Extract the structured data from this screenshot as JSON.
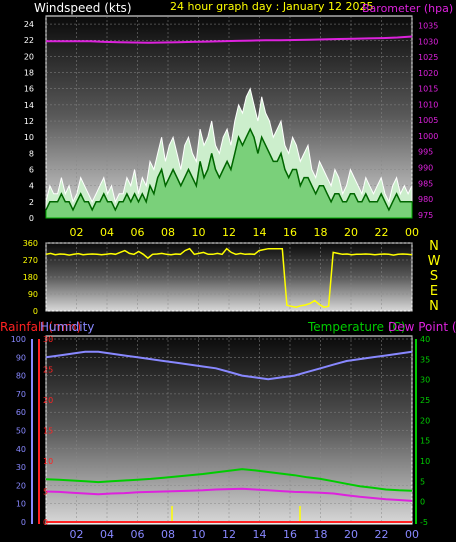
{
  "header": {
    "wind_label": "Windspeed (kts)",
    "title": "24 hour graph day :  January 12 2025",
    "baro_label": "Barometer (hpa)"
  },
  "colors": {
    "wind_label": "#ffffff",
    "title": "#ffff00",
    "baro": "#dd22dd",
    "wind_gust": "#ffffff",
    "wind_avg": "#00cc00",
    "wind_fill": "#cceecc",
    "dir": "#ffff00",
    "rain": "#ff2222",
    "humidity": "#8888ff",
    "temp": "#00cc00",
    "dew": "#dd22dd",
    "axis_yellow": "#ffff00"
  },
  "x_ticks": [
    "02",
    "04",
    "06",
    "08",
    "10",
    "12",
    "14",
    "16",
    "18",
    "20",
    "22",
    "00"
  ],
  "compass": [
    "N",
    "W",
    "S",
    "E",
    "N"
  ],
  "lower_labels": {
    "rain": "Rainfall (mm)",
    "humidity": "Humidity",
    "temp": "Temperature (C)",
    "dew": "Dew Point (C)"
  },
  "chart_data": [
    {
      "type": "area",
      "panel": "wind",
      "y_ticks": [
        "0",
        "2",
        "4",
        "6",
        "8",
        "10",
        "12",
        "14",
        "16",
        "18",
        "20",
        "22",
        "24"
      ],
      "ylim": [
        0,
        25
      ],
      "series": [
        {
          "name": "Windspeed (kts) gust",
          "values": [
            2,
            4,
            3,
            3,
            5,
            3,
            4,
            2,
            3,
            5,
            4,
            3,
            2,
            3,
            4,
            5,
            3,
            4,
            2,
            3,
            3,
            5,
            4,
            6,
            3,
            5,
            4,
            7,
            6,
            8,
            10,
            7,
            9,
            10,
            8,
            6,
            9,
            10,
            8,
            7,
            11,
            9,
            10,
            12,
            9,
            8,
            10,
            11,
            9,
            12,
            14,
            13,
            15,
            16,
            14,
            12,
            15,
            13,
            12,
            10,
            11,
            12,
            9,
            8,
            10,
            9,
            7,
            8,
            9,
            6,
            5,
            7,
            6,
            5,
            4,
            6,
            5,
            3,
            4,
            6,
            5,
            4,
            3,
            5,
            4,
            3,
            4,
            5,
            3,
            2,
            4,
            5,
            3,
            4,
            3,
            4
          ]
        },
        {
          "name": "Windspeed (kts) average",
          "values": [
            1,
            2,
            2,
            2,
            3,
            2,
            2,
            1,
            2,
            3,
            2,
            2,
            1,
            2,
            2,
            3,
            2,
            2,
            1,
            2,
            2,
            3,
            2,
            3,
            2,
            3,
            2,
            4,
            3,
            5,
            6,
            4,
            5,
            6,
            5,
            4,
            5,
            6,
            5,
            4,
            7,
            5,
            6,
            8,
            6,
            5,
            6,
            7,
            6,
            8,
            10,
            9,
            10,
            11,
            10,
            8,
            10,
            9,
            8,
            7,
            7,
            8,
            6,
            5,
            6,
            6,
            4,
            5,
            5,
            4,
            3,
            4,
            4,
            3,
            2,
            3,
            3,
            2,
            2,
            3,
            3,
            2,
            2,
            3,
            2,
            2,
            2,
            3,
            2,
            1,
            2,
            3,
            2,
            2,
            2,
            2
          ]
        }
      ]
    },
    {
      "type": "line",
      "panel": "barometer",
      "y_ticks": [
        "975",
        "980",
        "985",
        "990",
        "995",
        "1000",
        "1005",
        "1010",
        "1015",
        "1020",
        "1025",
        "1030",
        "1035"
      ],
      "ylim": [
        974,
        1038
      ],
      "series": [
        {
          "name": "Barometer (hpa)",
          "values": [
            1030,
            1030,
            1030,
            1030,
            1029.8,
            1029.7,
            1029.6,
            1029.5,
            1029.6,
            1029.7,
            1029.8,
            1029.9,
            1030,
            1030.1,
            1030.2,
            1030.3,
            1030.3,
            1030.4,
            1030.5,
            1030.6,
            1030.7,
            1030.8,
            1030.9,
            1031,
            1031.2,
            1031.5
          ]
        }
      ]
    },
    {
      "type": "line",
      "panel": "direction",
      "y_ticks": [
        "0",
        "90",
        "180",
        "270",
        "360"
      ],
      "ylim": [
        0,
        360
      ],
      "series": [
        {
          "name": "Wind direction",
          "values": [
            300,
            305,
            298,
            302,
            300,
            296,
            300,
            304,
            298,
            300,
            302,
            300,
            298,
            300,
            304,
            300,
            310,
            320,
            305,
            300,
            315,
            300,
            280,
            300,
            302,
            305,
            300,
            298,
            302,
            300,
            320,
            330,
            300,
            305,
            310,
            300,
            300,
            305,
            300,
            330,
            310,
            300,
            305,
            300,
            302,
            300,
            320,
            325,
            330,
            330,
            330,
            330,
            30,
            25,
            20,
            28,
            32,
            40,
            55,
            35,
            20,
            25,
            310,
            305,
            300,
            302,
            298,
            300,
            300,
            302,
            300,
            298,
            300,
            302,
            300,
            296,
            300,
            302,
            300,
            298
          ]
        }
      ]
    },
    {
      "type": "line",
      "panel": "lower",
      "x": [
        "00",
        "02",
        "04",
        "06",
        "08",
        "10",
        "12",
        "14",
        "16",
        "18",
        "20",
        "22",
        "00"
      ],
      "y_left_ticks": [
        "0",
        "10",
        "20",
        "30",
        "40",
        "50",
        "60",
        "70",
        "80",
        "90",
        "100"
      ],
      "y_rain_ticks": [
        "0",
        "5",
        "10",
        "15",
        "20",
        "25",
        "30"
      ],
      "y_right_ticks": [
        "-5",
        "0",
        "5",
        "10",
        "15",
        "20",
        "25",
        "30",
        "35",
        "40"
      ],
      "series": [
        {
          "name": "Humidity",
          "axis": "humidity",
          "values": [
            90,
            91,
            92,
            93,
            93,
            92,
            91,
            90,
            89,
            88,
            87,
            86,
            85,
            84,
            82,
            80,
            79,
            78,
            79,
            80,
            82,
            84,
            86,
            88,
            89,
            90,
            91,
            92,
            93
          ]
        },
        {
          "name": "Temperature (C)",
          "axis": "temp",
          "values": [
            5.5,
            5.4,
            5.2,
            5,
            4.8,
            5,
            5.2,
            5.4,
            5.6,
            5.9,
            6.2,
            6.5,
            6.8,
            7.2,
            7.6,
            8,
            7.7,
            7.3,
            6.9,
            6.5,
            6,
            5.6,
            5,
            4.4,
            3.8,
            3.4,
            3,
            2.8,
            2.7
          ]
        },
        {
          "name": "Dew Point (C)",
          "axis": "temp",
          "values": [
            2.5,
            2.4,
            2.2,
            2,
            1.8,
            2,
            2.1,
            2.3,
            2.4,
            2.5,
            2.6,
            2.7,
            2.8,
            3,
            3.1,
            3.2,
            3,
            2.8,
            2.6,
            2.4,
            2.3,
            2.2,
            2,
            1.6,
            1.2,
            0.9,
            0.6,
            0.4,
            0.2
          ]
        },
        {
          "name": "Rainfall (mm)",
          "axis": "rain",
          "values": [
            0,
            0,
            0,
            0,
            0,
            0,
            0,
            0,
            0,
            0,
            0,
            0,
            0,
            0,
            0,
            0,
            0,
            0,
            0,
            0,
            0,
            0,
            0,
            0,
            0,
            0,
            0,
            0,
            0
          ]
        }
      ]
    }
  ]
}
